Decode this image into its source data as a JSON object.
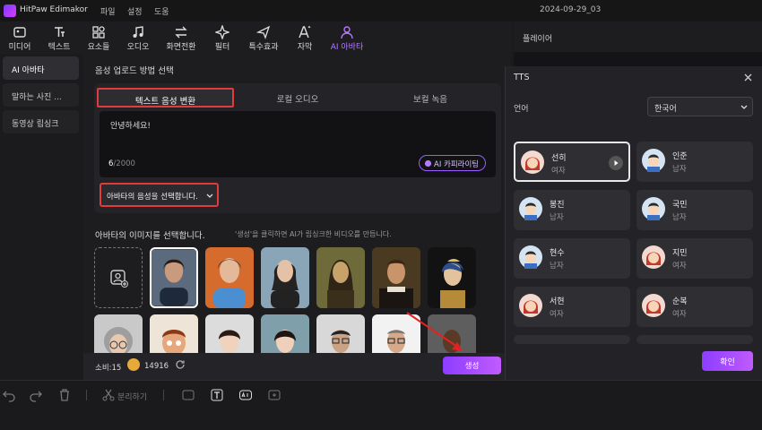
{
  "app": {
    "title": "HitPaw Edimakor",
    "menus": [
      "파일",
      "설정",
      "도움"
    ],
    "date_title": "2024-09-29_03"
  },
  "toolbar": [
    {
      "icon": "media-icon",
      "label": "미디어"
    },
    {
      "icon": "text-icon",
      "label": "텍스트"
    },
    {
      "icon": "elements-icon",
      "label": "요소들"
    },
    {
      "icon": "audio-icon",
      "label": "오디오"
    },
    {
      "icon": "transition-icon",
      "label": "화면전환"
    },
    {
      "icon": "filter-icon",
      "label": "필터"
    },
    {
      "icon": "effects-icon",
      "label": "특수효과"
    },
    {
      "icon": "caption-icon",
      "label": "자막"
    },
    {
      "icon": "ai-avatar-icon",
      "label": "AI 아바타",
      "active": true
    }
  ],
  "leftnav": [
    "AI 아바타",
    "말하는 사진 ...",
    "동영상 립싱크"
  ],
  "main": {
    "upload_title": "음성 업로드 방법 선택",
    "tabs": [
      "텍스트 음성 변환",
      "로컬 오디오",
      "보컬 녹음"
    ],
    "text_value": "안녕하세요!",
    "char_count": "6",
    "char_max": "/2000",
    "ai_copywriting": "AI 카피라이팅",
    "voice_select": "아바타의 음성을 선택합니다.",
    "image_title": "아바타의 이미지를 선택합니다.",
    "image_hint": "'생성'을 클릭하면 AI가 립싱크한 비디오를 만듭니다.",
    "consume_label": "소비:15",
    "credits": "14916",
    "generate": "생성"
  },
  "player": {
    "title": "플레이어"
  },
  "tts": {
    "title": "TTS",
    "language_label": "언어",
    "language_value": "한국어",
    "voices": [
      {
        "name": "선히",
        "gender": "여자"
      },
      {
        "name": "인준",
        "gender": "남자"
      },
      {
        "name": "봉진",
        "gender": "남자"
      },
      {
        "name": "국민",
        "gender": "남자"
      },
      {
        "name": "현수",
        "gender": "남자"
      },
      {
        "name": "지민",
        "gender": "여자"
      },
      {
        "name": "서현",
        "gender": "여자"
      },
      {
        "name": "순복",
        "gender": "여자"
      }
    ],
    "confirm": "확인"
  },
  "timeline": {
    "split_label": "분리하기"
  },
  "colors": {
    "accent": "#b27bff",
    "highlight": "#e23b3b",
    "button": "#8d3dff"
  }
}
